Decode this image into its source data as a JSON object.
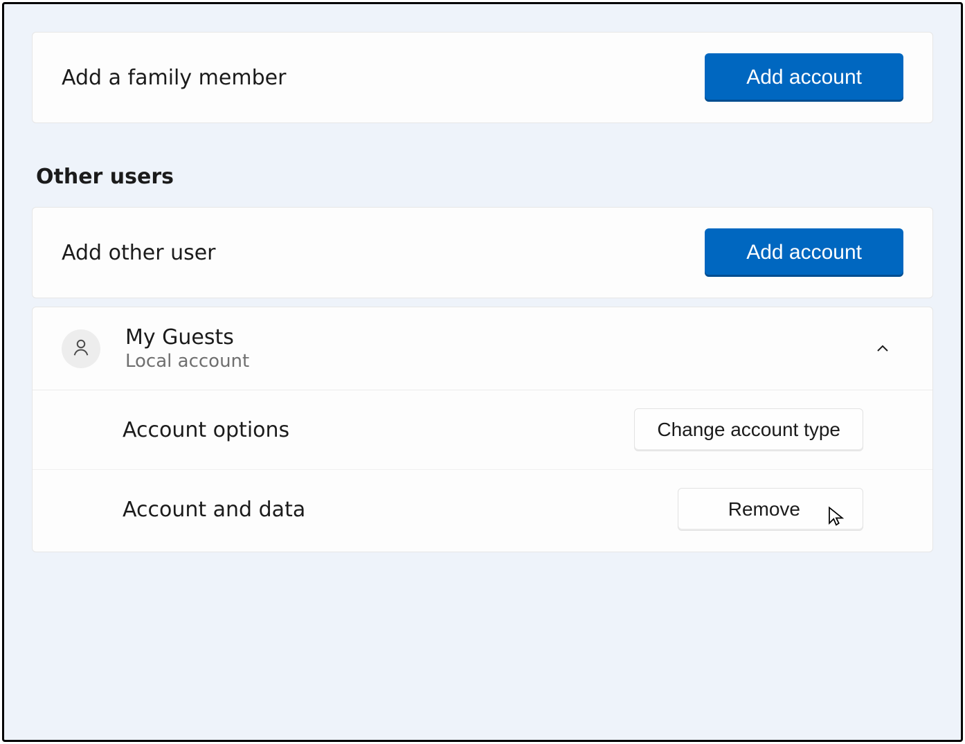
{
  "family": {
    "add_row_label": "Add a family member",
    "add_button_label": "Add account"
  },
  "other_users": {
    "heading": "Other users",
    "add_row_label": "Add other user",
    "add_button_label": "Add account",
    "user": {
      "name": "My Guests",
      "subtext": "Local account",
      "options_label": "Account options",
      "change_type_button": "Change account type",
      "data_label": "Account and data",
      "remove_button": "Remove"
    }
  }
}
